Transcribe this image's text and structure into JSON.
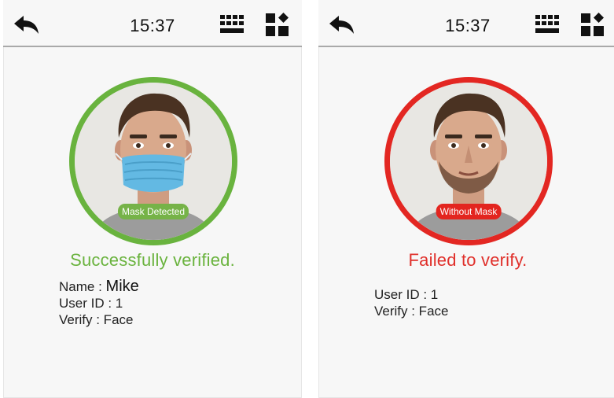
{
  "screens": [
    {
      "time": "15:37",
      "badge": "Mask Detected",
      "status": "Successfully verified.",
      "name_label": "Name : ",
      "name_value": "Mike",
      "user_id": "User ID : 1",
      "verify": "Verify : Face",
      "ring_color": "#69b33e"
    },
    {
      "time": "15:37",
      "badge": "Without Mask",
      "status": "Failed to verify.",
      "user_id": "User ID : 1",
      "verify": "Verify : Face",
      "ring_color": "#e32722"
    }
  ],
  "icons": {
    "back": "back-arrow-icon",
    "keyboard": "keyboard-icon",
    "menu": "menu-grid-icon"
  }
}
